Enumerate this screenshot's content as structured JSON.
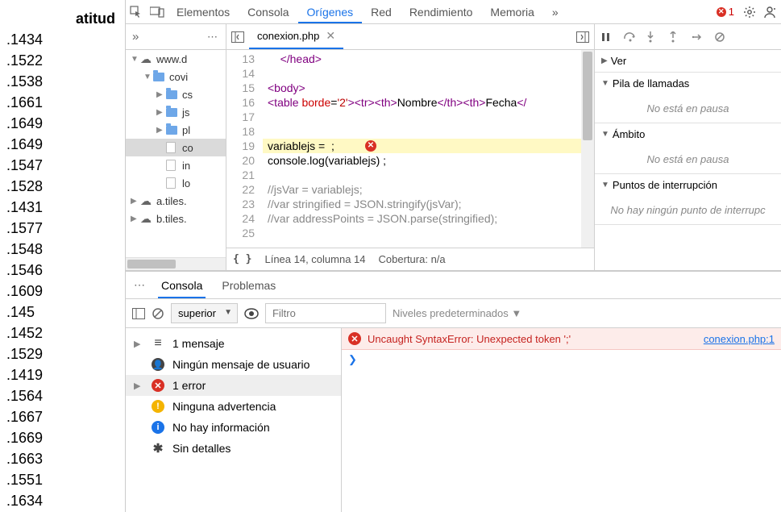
{
  "left_column": {
    "header": "atitud",
    "values": [
      ".1434",
      ".1522",
      ".1538",
      ".1661",
      ".1649",
      ".1649",
      ".1547",
      ".1528",
      ".1431",
      ".1577",
      ".1548",
      ".1546",
      ".1609",
      ".145",
      ".1452",
      ".1529",
      ".1419",
      ".1564",
      ".1667",
      ".1669",
      ".1663",
      ".1551",
      ".1634"
    ]
  },
  "topbar": {
    "tabs": [
      "Elementos",
      "Consola",
      "Orígenes",
      "Red",
      "Rendimiento",
      "Memoria"
    ],
    "active_index": 2,
    "overflow": "»",
    "error_count": "1"
  },
  "tree": {
    "overflow": "»",
    "nodes": [
      {
        "depth": 0,
        "expanded": true,
        "icon": "cloud",
        "label": "www.d"
      },
      {
        "depth": 1,
        "expanded": true,
        "icon": "folder",
        "label": "covi"
      },
      {
        "depth": 2,
        "expanded": false,
        "icon": "folder",
        "label": "cs"
      },
      {
        "depth": 2,
        "expanded": false,
        "icon": "folder",
        "label": "js"
      },
      {
        "depth": 2,
        "expanded": false,
        "icon": "folder",
        "label": "pl"
      },
      {
        "depth": 2,
        "expanded": false,
        "icon": "file",
        "label": "co",
        "selected": true
      },
      {
        "depth": 2,
        "expanded": false,
        "icon": "file",
        "label": "in"
      },
      {
        "depth": 2,
        "expanded": false,
        "icon": "file",
        "label": "lo"
      },
      {
        "depth": 0,
        "expanded": false,
        "icon": "cloud",
        "label": "a.tiles."
      },
      {
        "depth": 0,
        "expanded": false,
        "icon": "cloud",
        "label": "b.tiles."
      }
    ]
  },
  "editor": {
    "tab_name": "conexion.php",
    "first_line_no": 13,
    "lines": [
      {
        "n": 13,
        "html": "    <span class='tag'>&lt;/head&gt;</span>"
      },
      {
        "n": 14,
        "html": ""
      },
      {
        "n": 15,
        "html": "<span class='tag'>&lt;body&gt;</span>"
      },
      {
        "n": 16,
        "html": "<span class='tag'>&lt;table</span> <span class='attr'>borde</span>=<span class='str'>'2'</span><span class='tag'>&gt;&lt;tr&gt;&lt;th&gt;</span>Nombre<span class='tag'>&lt;/th&gt;&lt;th&gt;</span>Fecha<span class='tag'>&lt;/</span>"
      },
      {
        "n": 17,
        "html": ""
      },
      {
        "n": 18,
        "html": ""
      },
      {
        "n": 19,
        "html": "variablejs = <span style='color:#c00'>&nbsp;</span>;",
        "hl": true,
        "err": true
      },
      {
        "n": 20,
        "html": "console.log(variablejs) ;"
      },
      {
        "n": 21,
        "html": ""
      },
      {
        "n": 22,
        "html": "<span class='com'>//jsVar = variablejs;</span>"
      },
      {
        "n": 23,
        "html": "<span class='com'>//var stringified = JSON.stringify(jsVar);</span>"
      },
      {
        "n": 24,
        "html": "<span class='com'>//var addressPoints = JSON.parse(stringified);</span>"
      },
      {
        "n": 25,
        "html": ""
      }
    ],
    "status": {
      "pos": "Línea 14, columna 14",
      "cov": "Cobertura: n/a"
    }
  },
  "debug": {
    "sections": [
      {
        "title": "Ver",
        "open": false
      },
      {
        "title": "Pila de llamadas",
        "open": true,
        "body": "No está en pausa"
      },
      {
        "title": "Ámbito",
        "open": true,
        "body": "No está en pausa"
      },
      {
        "title": "Puntos de interrupción",
        "open": true,
        "body": "No hay ningún punto de interrupc"
      }
    ]
  },
  "console_panel": {
    "tabs": [
      "Consola",
      "Problemas"
    ],
    "active_index": 0,
    "context": "superior",
    "filter_placeholder": "Filtro",
    "levels_label": "Niveles predeterminados ▼",
    "summary": [
      {
        "icon": "msg",
        "text": "1 mensaje",
        "arrow": true
      },
      {
        "icon": "user",
        "text": "Ningún mensaje de usuario"
      },
      {
        "icon": "err",
        "text": "1 error",
        "arrow": true,
        "selected": true
      },
      {
        "icon": "warn",
        "text": "Ninguna advertencia"
      },
      {
        "icon": "info",
        "text": "No hay información"
      },
      {
        "icon": "det",
        "text": "Sin detalles"
      }
    ],
    "error": {
      "msg": "Uncaught SyntaxError: Unexpected token ';'",
      "src": "conexion.php:1"
    }
  }
}
